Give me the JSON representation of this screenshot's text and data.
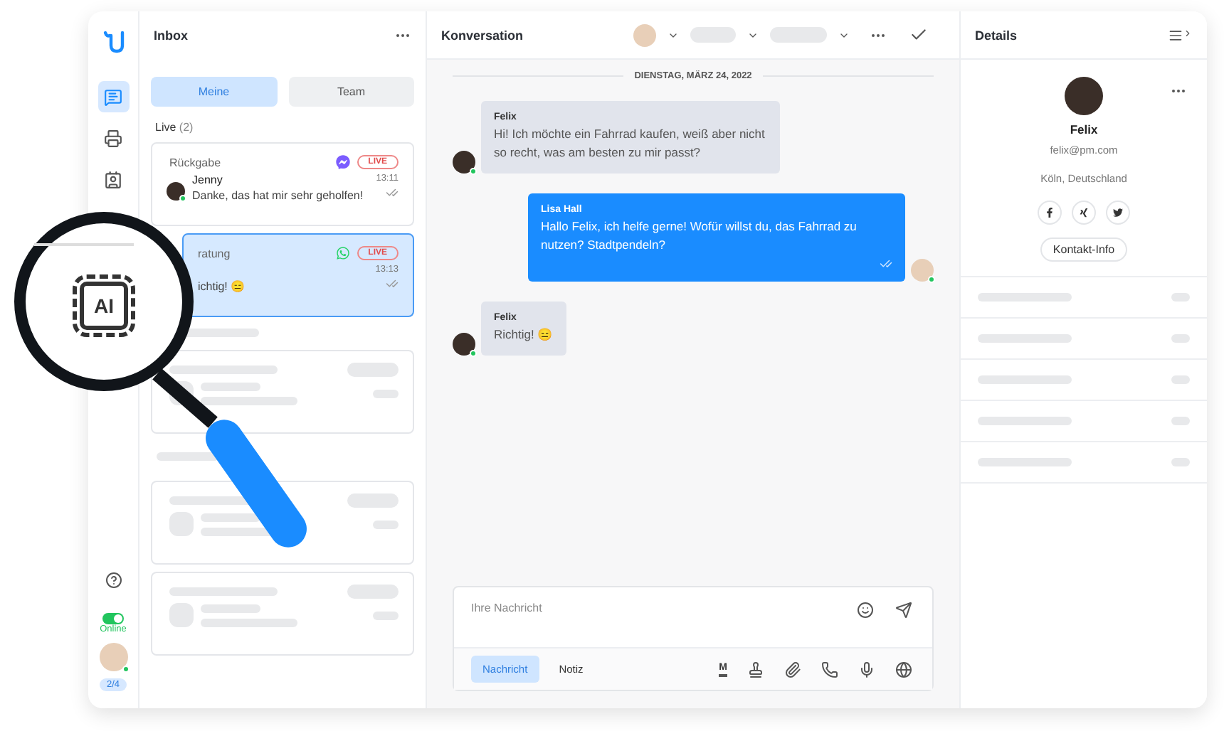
{
  "sidebar": {
    "nav": [
      {
        "kind": "chat",
        "selected": true
      },
      {
        "kind": "tray",
        "selected": false
      },
      {
        "kind": "contact",
        "selected": false
      }
    ],
    "status": {
      "on": true,
      "label": "Online"
    },
    "counter": "2/4"
  },
  "inbox": {
    "title": "Inbox",
    "tabs": [
      {
        "label": "Meine",
        "selected": true
      },
      {
        "label": "Team",
        "selected": false
      }
    ],
    "section": {
      "label": "Live",
      "count": "(2)"
    },
    "conversations": [
      {
        "topic": "Rückgabe",
        "kind": "messenger",
        "badge": "LIVE",
        "name": "Jenny",
        "time": "13:11",
        "preview": "Danke, das hat mir sehr geholfen!",
        "selected": false
      },
      {
        "topic": "ratung",
        "kind": "whatsapp",
        "badge": "LIVE",
        "time": "13:13",
        "preview": "ichtig! 😑",
        "selected": true
      }
    ]
  },
  "conversation": {
    "title": "Konversation",
    "date": "DIENSTAG, MÄRZ 24, 2022",
    "messages": [
      {
        "sender": "Felix",
        "text": "Hi! Ich möchte ein Fahrrad kaufen, weiß aber nicht so recht, was am besten zu mir passt?",
        "outgoing": false
      },
      {
        "sender": "Lisa Hall",
        "text": "Hallo Felix, ich helfe gerne! Wofür willst du, das Fahrrad zu nutzen? Stadtpendeln?",
        "outgoing": true
      },
      {
        "sender": "Felix",
        "text": "Richtig! 😑",
        "outgoing": false
      }
    ],
    "composer": {
      "placeholder": "Ihre Nachricht",
      "modes": [
        {
          "label": "Nachricht",
          "selected": true
        },
        {
          "label": "Notiz",
          "selected": false
        }
      ],
      "format_mark": "M"
    }
  },
  "details": {
    "title": "Details",
    "contact": {
      "name": "Felix",
      "email": "felix@pm.com",
      "location": "Köln, Deutschland",
      "button": "Kontakt-Info"
    }
  },
  "magnifier": {
    "label": "AI"
  }
}
